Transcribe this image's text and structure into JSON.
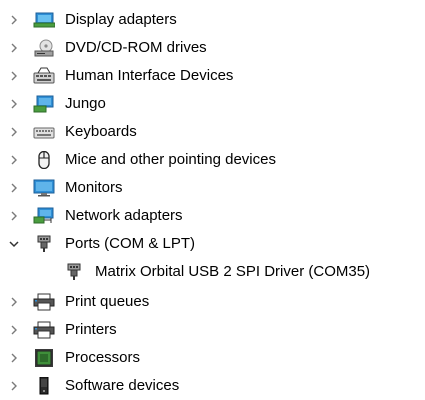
{
  "device_tree": {
    "items": [
      {
        "label": "Display adapters",
        "icon": "display-adapter-icon",
        "expanded": false
      },
      {
        "label": "DVD/CD-ROM drives",
        "icon": "dvd-drive-icon",
        "expanded": false
      },
      {
        "label": "Human Interface Devices",
        "icon": "hid-icon",
        "expanded": false
      },
      {
        "label": "Jungo",
        "icon": "jungo-monitor-icon",
        "expanded": false
      },
      {
        "label": "Keyboards",
        "icon": "keyboard-icon",
        "expanded": false
      },
      {
        "label": "Mice and other pointing devices",
        "icon": "mouse-icon",
        "expanded": false
      },
      {
        "label": "Monitors",
        "icon": "monitor-icon",
        "expanded": false
      },
      {
        "label": "Network adapters",
        "icon": "network-adapter-icon",
        "expanded": false
      },
      {
        "label": "Ports (COM & LPT)",
        "icon": "port-connector-icon",
        "expanded": true,
        "children": [
          {
            "label": "Matrix Orbital USB 2 SPI Driver (COM35)",
            "icon": "port-connector-icon"
          }
        ]
      },
      {
        "label": "Print queues",
        "icon": "print-queue-icon",
        "expanded": false
      },
      {
        "label": "Printers",
        "icon": "printer-icon",
        "expanded": false
      },
      {
        "label": "Processors",
        "icon": "processor-icon",
        "expanded": false
      },
      {
        "label": "Software devices",
        "icon": "software-device-icon",
        "expanded": false
      }
    ]
  }
}
